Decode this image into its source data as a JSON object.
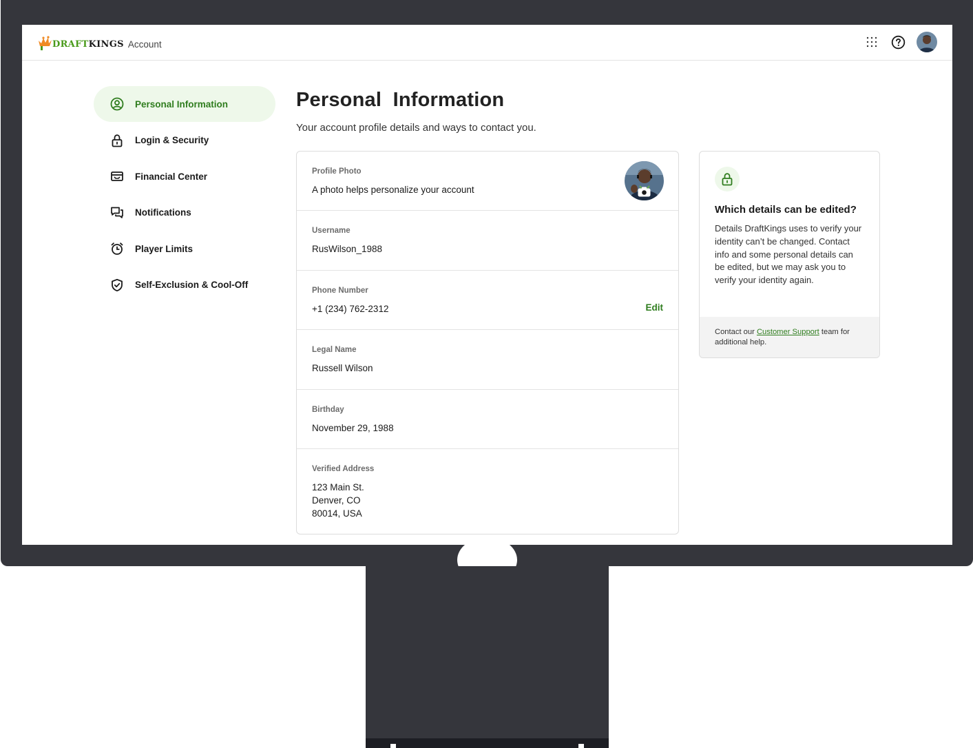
{
  "header": {
    "brand_draft": "DRAFT",
    "brand_kings": "KINGS",
    "brand_suffix": "Account"
  },
  "sidebar": {
    "items": [
      {
        "label": "Personal Information",
        "icon": "user-circle-icon",
        "active": true
      },
      {
        "label": "Login & Security",
        "icon": "lock-icon"
      },
      {
        "label": "Financial Center",
        "icon": "wallet-icon"
      },
      {
        "label": "Notifications",
        "icon": "chat-bubbles-icon"
      },
      {
        "label": "Player Limits",
        "icon": "alarm-clock-icon"
      },
      {
        "label": "Self-Exclusion & Cool-Off",
        "icon": "shield-check-icon"
      }
    ]
  },
  "main": {
    "title": "Personal  Information",
    "subtitle": "Your account profile details and ways to contact you.",
    "rows": [
      {
        "label": "Profile Photo",
        "value": "A photo helps personalize your account"
      },
      {
        "label": "Username",
        "value": "RusWilson_1988"
      },
      {
        "label": "Phone Number",
        "value": "+1 (234) 762-2312",
        "action": "Edit"
      },
      {
        "label": "Legal Name",
        "value": "Russell Wilson"
      },
      {
        "label": "Birthday",
        "value": "November 29, 1988"
      },
      {
        "label": "Verified Address",
        "lines": [
          "123 Main St.",
          "Denver, CO",
          "80014, USA"
        ]
      }
    ]
  },
  "info": {
    "title": "Which details can be edited?",
    "body": "Details DraftKings uses to verify your identity can’t be changed. Contact info and some personal details can be edited, but we may ask you to verify your identity again.",
    "footer_prefix": "Contact our ",
    "footer_link": "Customer Support",
    "footer_suffix": " team for additional help."
  },
  "colors": {
    "accent": "#2f7d1e",
    "accent_bg": "#eef8ea",
    "frame": "#35363c"
  }
}
